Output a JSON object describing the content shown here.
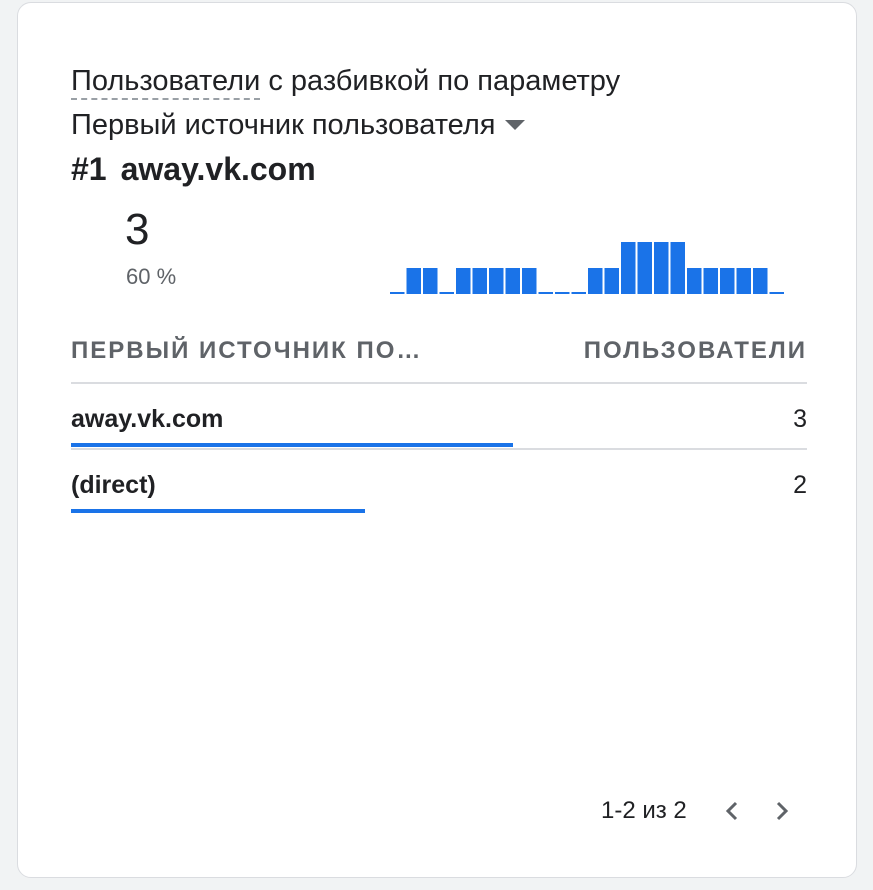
{
  "card": {
    "title_part1": "Пользователи",
    "title_part2": " с разбивкой по параметру",
    "dimension_label": "Первый источник пользователя",
    "top": {
      "rank": "#1",
      "name": "away.vk.com",
      "value": "3",
      "percent": "60 %"
    },
    "sparkline_values": [
      0,
      1,
      1,
      0,
      1,
      1,
      1,
      1,
      1,
      0,
      0,
      0,
      1,
      1,
      2,
      2,
      2,
      2,
      1,
      1,
      1,
      1,
      1,
      0
    ],
    "columns": {
      "dimension": "ПЕРВЫЙ ИСТОЧНИК ПО…",
      "metric": "ПОЛЬЗОВАТЕЛИ"
    },
    "rows": [
      {
        "name": "away.vk.com",
        "value": "3",
        "share": 0.6
      },
      {
        "name": "(direct)",
        "value": "2",
        "share": 0.4
      }
    ],
    "pagination": {
      "range": "1-2 из 2"
    },
    "colors": {
      "accent": "#1a73e8",
      "muted": "#5f6368",
      "divider": "#dadce0"
    },
    "icons": {
      "dropdown": "caret-down-icon",
      "prev": "chevron-left-icon",
      "next": "chevron-right-icon"
    }
  }
}
